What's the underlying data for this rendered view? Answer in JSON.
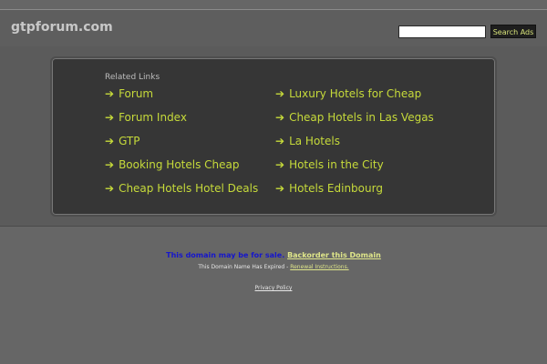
{
  "header": {
    "logo": "gtpforum.com",
    "search_button": "Search Ads"
  },
  "related": {
    "title": "Related Links",
    "arrow": "➔",
    "left_links": [
      "Forum",
      "Forum Index",
      "GTP",
      "Booking Hotels Cheap",
      "Cheap Hotels Hotel Deals"
    ],
    "right_links": [
      "Luxury Hotels for Cheap",
      "Cheap Hotels in Las Vegas",
      "La Hotels",
      "Hotels in the City",
      "Hotels Edinbourg"
    ]
  },
  "footer": {
    "sale_text": "This domain may be for sale.",
    "backorder": "Backorder this Domain",
    "expired_text": "This Domain Name Has Expired -",
    "renewal": "Renewal Instructions.",
    "privacy": "Privacy Policy"
  },
  "colors": {
    "link": "#c6da3a",
    "background": "#666666",
    "panel": "#363636"
  }
}
